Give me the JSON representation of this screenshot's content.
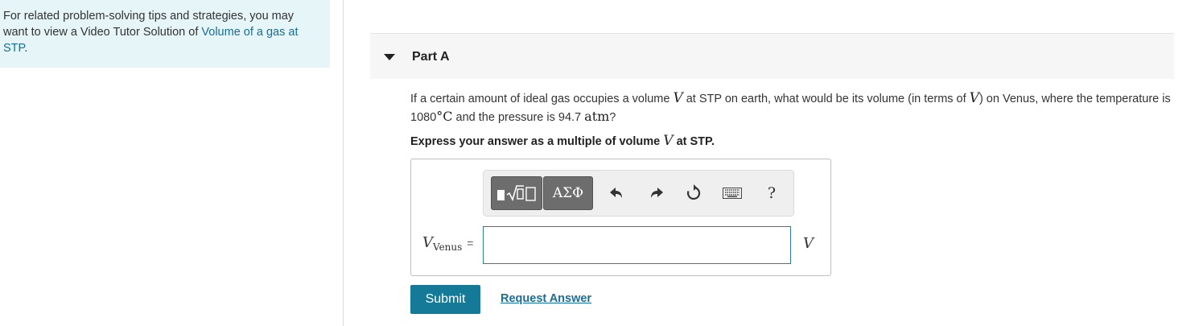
{
  "tip": {
    "text": "For related problem-solving tips and strategies, you may want to view a Video Tutor Solution of ",
    "link": "Volume of a gas at STP",
    "end": "."
  },
  "part": {
    "title": "Part A"
  },
  "question": {
    "t1": "If a certain amount of ideal gas occupies a volume ",
    "v1": "V",
    "t2": " at STP on earth, what would be its volume (in terms of ",
    "v2": "V",
    "t3": ") on Venus, where the temperature is 1080",
    "deg": "°C",
    "t4": " and the pressure is 94.7 ",
    "atm": "atm",
    "t5": "?"
  },
  "instruction": {
    "t1": "Express your answer as a multiple of volume ",
    "v": "V",
    "t2": " at STP."
  },
  "toolbar": {
    "symbols_label": "ΑΣΦ",
    "help_label": "?",
    "icons": [
      "templates-icon",
      "undo-icon",
      "redo-icon",
      "reset-icon",
      "keyboard-icon",
      "help-icon"
    ]
  },
  "answer": {
    "var": "V",
    "sub": "Venus",
    "eq": "=",
    "value": "",
    "unit": "V"
  },
  "actions": {
    "submit": "Submit",
    "request": "Request Answer"
  },
  "colors": {
    "accent": "#147a98",
    "link": "#1a6d96",
    "tip_bg": "#e6f5f8"
  }
}
